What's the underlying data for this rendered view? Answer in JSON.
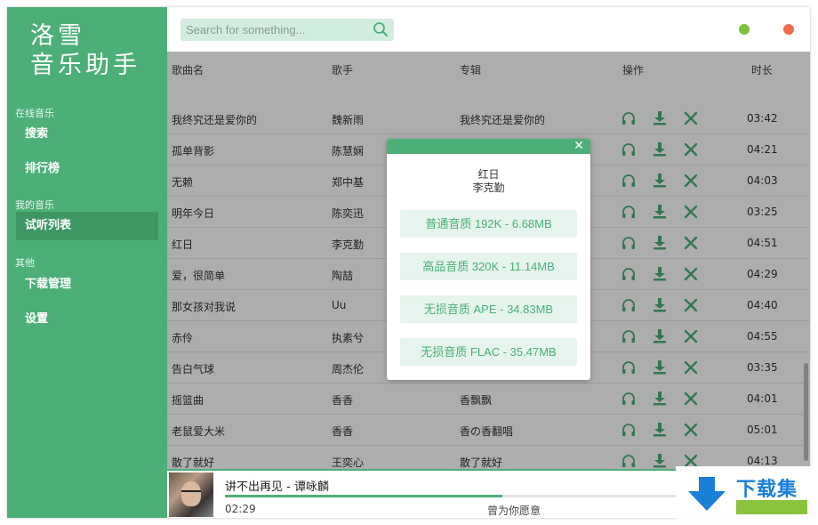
{
  "app": {
    "logo_line1": "洛雪",
    "logo_line2": "音乐助手"
  },
  "sidebar": {
    "sections": [
      {
        "label": "在线音乐",
        "items": [
          "搜索",
          "排行榜"
        ]
      },
      {
        "label": "我的音乐",
        "items": [
          "试听列表"
        ]
      },
      {
        "label": "其他",
        "items": [
          "下载管理",
          "设置"
        ]
      }
    ],
    "active_item": "试听列表"
  },
  "search": {
    "placeholder": "Search for something..."
  },
  "window_controls": {
    "minimize_color": "#7cc23a",
    "close_color": "#ef6b4e"
  },
  "table": {
    "headers": {
      "name": "歌曲名",
      "singer": "歌手",
      "album": "专辑",
      "ops": "操作",
      "duration": "时长"
    },
    "rows": [
      {
        "name": "我终究还是爱你的",
        "singer": "魏新雨",
        "album": "我终究还是爱你的",
        "duration": "03:42"
      },
      {
        "name": "孤单背影",
        "singer": "陈慧娴",
        "album": "",
        "duration": "04:21"
      },
      {
        "name": "无赖",
        "singer": "郑中基",
        "album": "",
        "duration": "04:03"
      },
      {
        "name": "明年今日",
        "singer": "陈奕迅",
        "album": "",
        "duration": "03:25"
      },
      {
        "name": "红日",
        "singer": "李克勤",
        "album": "",
        "duration": "04:51"
      },
      {
        "name": "爱，很简单",
        "singer": "陶喆",
        "album": "",
        "duration": "04:29"
      },
      {
        "name": "那女孩对我说",
        "singer": "Uu",
        "album": "",
        "duration": "04:40"
      },
      {
        "name": "赤伶",
        "singer": "执素兮",
        "album": "",
        "duration": "04:55"
      },
      {
        "name": "告白气球",
        "singer": "周杰伦",
        "album": "",
        "duration": "03:35"
      },
      {
        "name": "摇篮曲",
        "singer": "香香",
        "album": "香飘飘",
        "duration": "04:01"
      },
      {
        "name": "老鼠爱大米",
        "singer": "香香",
        "album": "香の香翻唱",
        "duration": "05:01"
      },
      {
        "name": "散了就好",
        "singer": "王奕心",
        "album": "散了就好",
        "duration": "04:13"
      }
    ]
  },
  "dialog": {
    "close_glyph": "✕",
    "title": "红日",
    "artist": "李克勤",
    "options": [
      "普通音质 192K - 6.68MB",
      "高品音质 320K - 11.14MB",
      "无损音质 APE - 34.83MB",
      "无损音质 FLAC - 35.47MB"
    ]
  },
  "player": {
    "title": "讲不出再见 - 谭咏麟",
    "time": "02:29",
    "lyric": "曾为你愿意",
    "progress": 0.6
  },
  "watermark": {
    "text": "下载集"
  }
}
